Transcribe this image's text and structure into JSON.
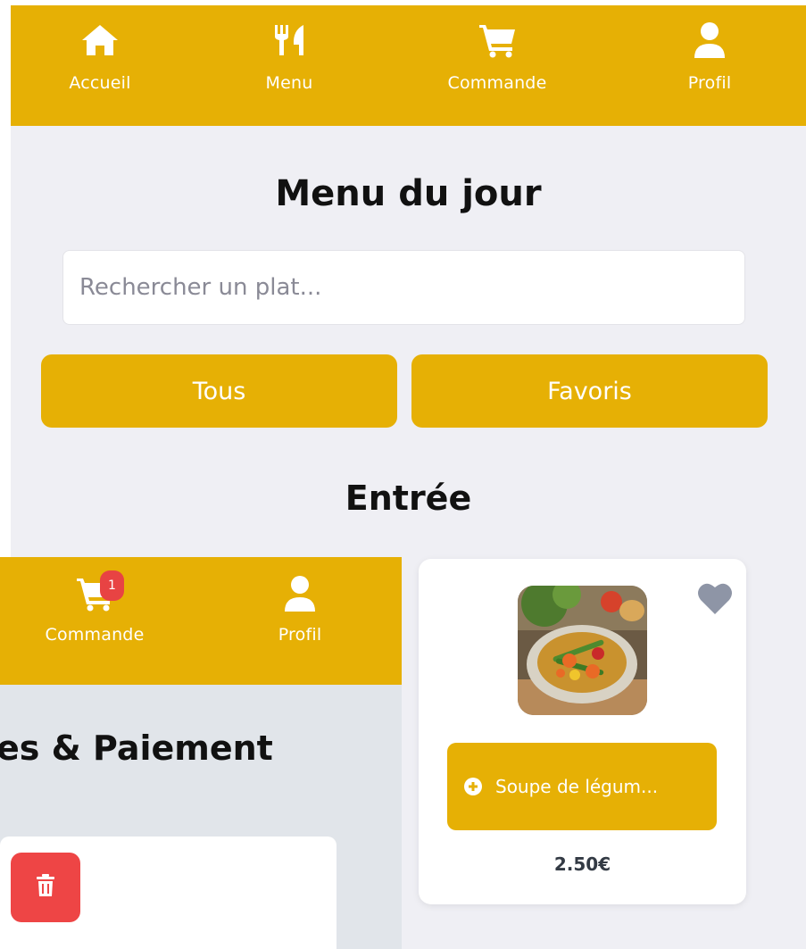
{
  "menu_screen": {
    "nav": [
      {
        "label": "Accueil",
        "icon": "home-icon"
      },
      {
        "label": "Menu",
        "icon": "utensils-icon"
      },
      {
        "label": "Commande",
        "icon": "cart-icon"
      },
      {
        "label": "Profil",
        "icon": "user-icon"
      }
    ],
    "title": "Menu du jour",
    "search": {
      "placeholder": "Rechercher un plat...",
      "value": ""
    },
    "filters": {
      "all": "Tous",
      "favorites": "Favoris"
    },
    "section_title": "Entrée",
    "dish": {
      "name": "Soupe de légum...",
      "price": "2.50€",
      "favorite_icon": "heart-icon",
      "add_icon": "plus-circle-icon"
    }
  },
  "order_screen": {
    "nav": [
      {
        "label": "Commande",
        "icon": "cart-icon",
        "badge": "1"
      },
      {
        "label": "Profil",
        "icon": "user-icon"
      }
    ],
    "title": "es & Paiement",
    "delete_icon": "trash-icon"
  },
  "colors": {
    "accent": "#e6b005",
    "background": "#efeff4",
    "danger": "#ee4545",
    "heart": "#8e95a6"
  }
}
